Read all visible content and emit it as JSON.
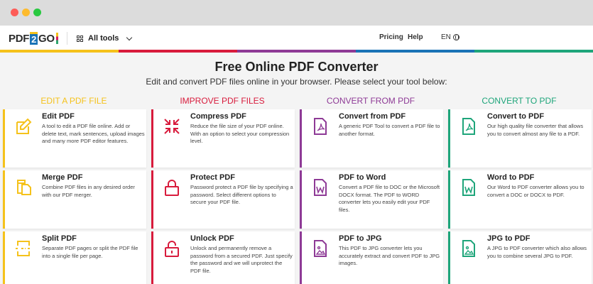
{
  "navbar": {
    "logo_pdf": "PDF",
    "logo_two": "2",
    "logo_go": "GO",
    "all_tools_label": "All tools",
    "pricing_label": "Pricing",
    "help_label": "Help",
    "language_label": "EN"
  },
  "header": {
    "title": "Free Online PDF Converter",
    "subtitle": "Edit and convert PDF files online in your browser. Please select your tool below:"
  },
  "colors": {
    "edit": "#f5c21b",
    "improve": "#d81b3c",
    "convert_from": "#8e3a96",
    "convert_to": "#1ea57a",
    "colorbar": [
      "#f5c21b",
      "#d81b3c",
      "#8e3a96",
      "#1a73b6",
      "#1ea57a"
    ]
  },
  "columns": [
    {
      "header": "EDIT A PDF FILE",
      "tools": [
        {
          "title": "Edit PDF",
          "description": "A tool to edit a PDF file online. Add or delete text, mark sentences, upload images and many more PDF editor features.",
          "icon": "edit-pencil-icon"
        },
        {
          "title": "Merge PDF",
          "description": "Combine PDF files in any desired order with our PDF merger.",
          "icon": "merge-files-icon"
        },
        {
          "title": "Split PDF",
          "description": "Separate PDF pages or split the PDF file into a single file per page.",
          "icon": "split-page-icon"
        }
      ]
    },
    {
      "header": "IMPROVE PDF FILES",
      "tools": [
        {
          "title": "Compress PDF",
          "description": "Reduce the file size of your PDF online. With an option to select your compression level.",
          "icon": "compress-arrows-icon"
        },
        {
          "title": "Protect PDF",
          "description": "Password protect a PDF file by specifying a password. Select different options to secure your PDF file.",
          "icon": "lock-icon"
        },
        {
          "title": "Unlock PDF",
          "description": "Unlock and permanently remove a password from a secured PDF. Just specify the password and we will unprotect the PDF file.",
          "icon": "unlock-icon"
        }
      ]
    },
    {
      "header": "CONVERT FROM PDF",
      "tools": [
        {
          "title": "Convert from PDF",
          "description": "A generic PDF Tool to convert a PDF file to another format.",
          "icon": "pdf-file-icon"
        },
        {
          "title": "PDF to Word",
          "description": "Convert a PDF file to DOC or the Microsoft DOCX format. The PDF to WORD converter lets you easily edit your PDF files.",
          "icon": "word-file-icon"
        },
        {
          "title": "PDF to JPG",
          "description": "This PDF to JPG converter lets you accurately extract and convert PDF to JPG images.",
          "icon": "image-file-icon"
        }
      ]
    },
    {
      "header": "CONVERT TO PDF",
      "tools": [
        {
          "title": "Convert to PDF",
          "description": "Our high quality file converter that allows you to convert almost any file to a PDF.",
          "icon": "pdf-file-icon"
        },
        {
          "title": "Word to PDF",
          "description": "Our Word to PDF converter allows you to convert a DOC or DOCX to PDF.",
          "icon": "word-file-icon"
        },
        {
          "title": "JPG to PDF",
          "description": "A JPG to PDF converter which also allows you to combine several JPG to PDF.",
          "icon": "image-file-icon"
        }
      ]
    }
  ]
}
